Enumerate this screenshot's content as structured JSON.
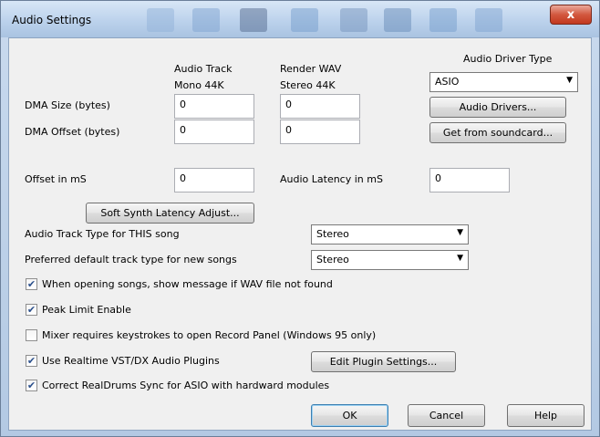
{
  "window": {
    "title": "Audio Settings",
    "close_label": "x"
  },
  "columns": {
    "audio_track": "Audio Track",
    "audio_track_sub": "Mono 44K",
    "render_wav": "Render WAV",
    "render_wav_sub": "Stereo 44K"
  },
  "driver": {
    "label": "Audio Driver Type",
    "selected": "ASIO",
    "drivers_button": "Audio Drivers...",
    "soundcard_button": "Get from soundcard..."
  },
  "dma": {
    "size_label": "DMA Size (bytes)",
    "offset_label": "DMA Offset (bytes)",
    "size_track": "0",
    "size_render": "0",
    "offset_track": "0",
    "offset_render": "0"
  },
  "offset": {
    "label": "Offset in mS",
    "value": "0"
  },
  "latency": {
    "label": "Audio Latency in mS",
    "value": "0"
  },
  "soft_synth_button": "Soft Synth Latency Adjust...",
  "track_type": {
    "label": "Audio Track Type for THIS song",
    "value": "Stereo"
  },
  "default_type": {
    "label": "Preferred default track type for new songs",
    "value": "Stereo"
  },
  "checkboxes": [
    {
      "label": "When opening songs, show message if WAV file not found",
      "checked": true
    },
    {
      "label": "Peak Limit Enable",
      "checked": true
    },
    {
      "label": "Mixer requires keystrokes to open Record Panel (Windows 95 only)",
      "checked": false
    },
    {
      "label": "Use Realtime VST/DX Audio Plugins",
      "checked": true
    },
    {
      "label": "Correct RealDrums Sync for ASIO with hardward modules",
      "checked": true
    }
  ],
  "plugin_button": "Edit Plugin Settings...",
  "footer": {
    "ok": "OK",
    "cancel": "Cancel",
    "help": "Help"
  }
}
